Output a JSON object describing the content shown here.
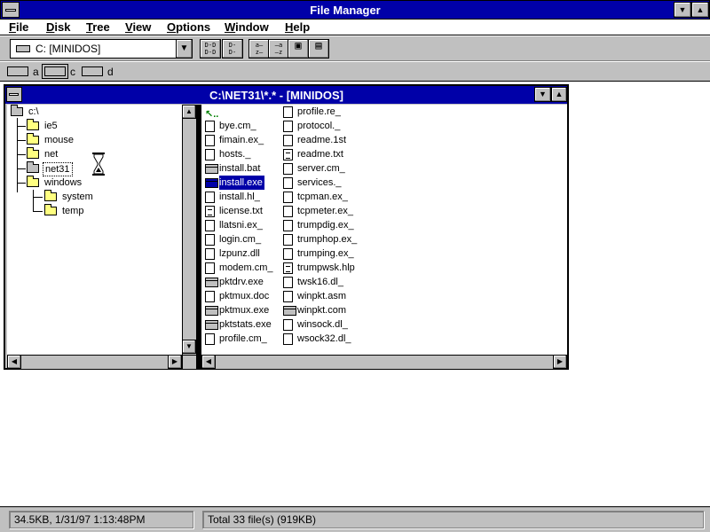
{
  "app": {
    "title": "File Manager"
  },
  "menu": [
    "File",
    "Disk",
    "Tree",
    "View",
    "Options",
    "Window",
    "Help"
  ],
  "toolbar": {
    "drive_value": "C: [MINIDOS]",
    "buttons": [
      {
        "name": "view-by-name",
        "glyph": "D-D\nD-D"
      },
      {
        "name": "view-all-details",
        "glyph": "D-\nD-"
      },
      {
        "name": "sort-by-name",
        "glyph": "a─\nz─"
      },
      {
        "name": "sort-by-type",
        "glyph": "─a\n─z"
      },
      {
        "name": "new-window",
        "glyph": "▣"
      },
      {
        "name": "properties",
        "glyph": "▤"
      }
    ]
  },
  "drives": [
    {
      "letter": "a",
      "selected": false
    },
    {
      "letter": "c",
      "selected": true
    },
    {
      "letter": "d",
      "selected": false
    }
  ],
  "child": {
    "title": "C:\\NET31\\*.* - [MINIDOS]"
  },
  "tree": {
    "root": "c:\\",
    "nodes": [
      {
        "name": "ie5",
        "level": 1,
        "open": false
      },
      {
        "name": "mouse",
        "level": 1,
        "open": false
      },
      {
        "name": "net",
        "level": 1,
        "open": false
      },
      {
        "name": "net31",
        "level": 1,
        "open": true,
        "selected": true
      },
      {
        "name": "windows",
        "level": 1,
        "open": false
      },
      {
        "name": "system",
        "level": 2,
        "open": false
      },
      {
        "name": "temp",
        "level": 2,
        "open": false
      }
    ]
  },
  "files": {
    "col1": [
      {
        "name": "bye.cm_",
        "type": "doc"
      },
      {
        "name": "fimain.ex_",
        "type": "doc"
      },
      {
        "name": "hosts._",
        "type": "doc"
      },
      {
        "name": "install.bat",
        "type": "exe"
      },
      {
        "name": "install.exe",
        "type": "exe",
        "selected": true
      },
      {
        "name": "install.hl_",
        "type": "doc"
      },
      {
        "name": "license.txt",
        "type": "txt"
      },
      {
        "name": "llatsni.ex_",
        "type": "doc"
      },
      {
        "name": "login.cm_",
        "type": "doc"
      },
      {
        "name": "lzpunz.dll",
        "type": "doc"
      },
      {
        "name": "modem.cm_",
        "type": "doc"
      },
      {
        "name": "pktdrv.exe",
        "type": "exe"
      },
      {
        "name": "pktmux.doc",
        "type": "doc"
      },
      {
        "name": "pktmux.exe",
        "type": "exe"
      },
      {
        "name": "pktstats.exe",
        "type": "exe"
      },
      {
        "name": "profile.cm_",
        "type": "doc"
      }
    ],
    "col2": [
      {
        "name": "profile.re_",
        "type": "doc"
      },
      {
        "name": "protocol._",
        "type": "doc"
      },
      {
        "name": "readme.1st",
        "type": "doc"
      },
      {
        "name": "readme.txt",
        "type": "txt"
      },
      {
        "name": "server.cm_",
        "type": "doc"
      },
      {
        "name": "services._",
        "type": "doc"
      },
      {
        "name": "tcpman.ex_",
        "type": "doc"
      },
      {
        "name": "tcpmeter.ex_",
        "type": "doc"
      },
      {
        "name": "trumpdig.ex_",
        "type": "doc"
      },
      {
        "name": "trumphop.ex_",
        "type": "doc"
      },
      {
        "name": "trumping.ex_",
        "type": "doc"
      },
      {
        "name": "trumpwsk.hlp",
        "type": "txt"
      },
      {
        "name": "twsk16.dl_",
        "type": "doc"
      },
      {
        "name": "winpkt.asm",
        "type": "doc"
      },
      {
        "name": "winpkt.com",
        "type": "exe"
      },
      {
        "name": "winsock.dl_",
        "type": "doc"
      },
      {
        "name": "wsock32.dl_",
        "type": "doc"
      }
    ]
  },
  "status": {
    "left": "34.5KB, 1/31/97 1:13:48PM",
    "right": "Total 33 file(s) (919KB)"
  }
}
